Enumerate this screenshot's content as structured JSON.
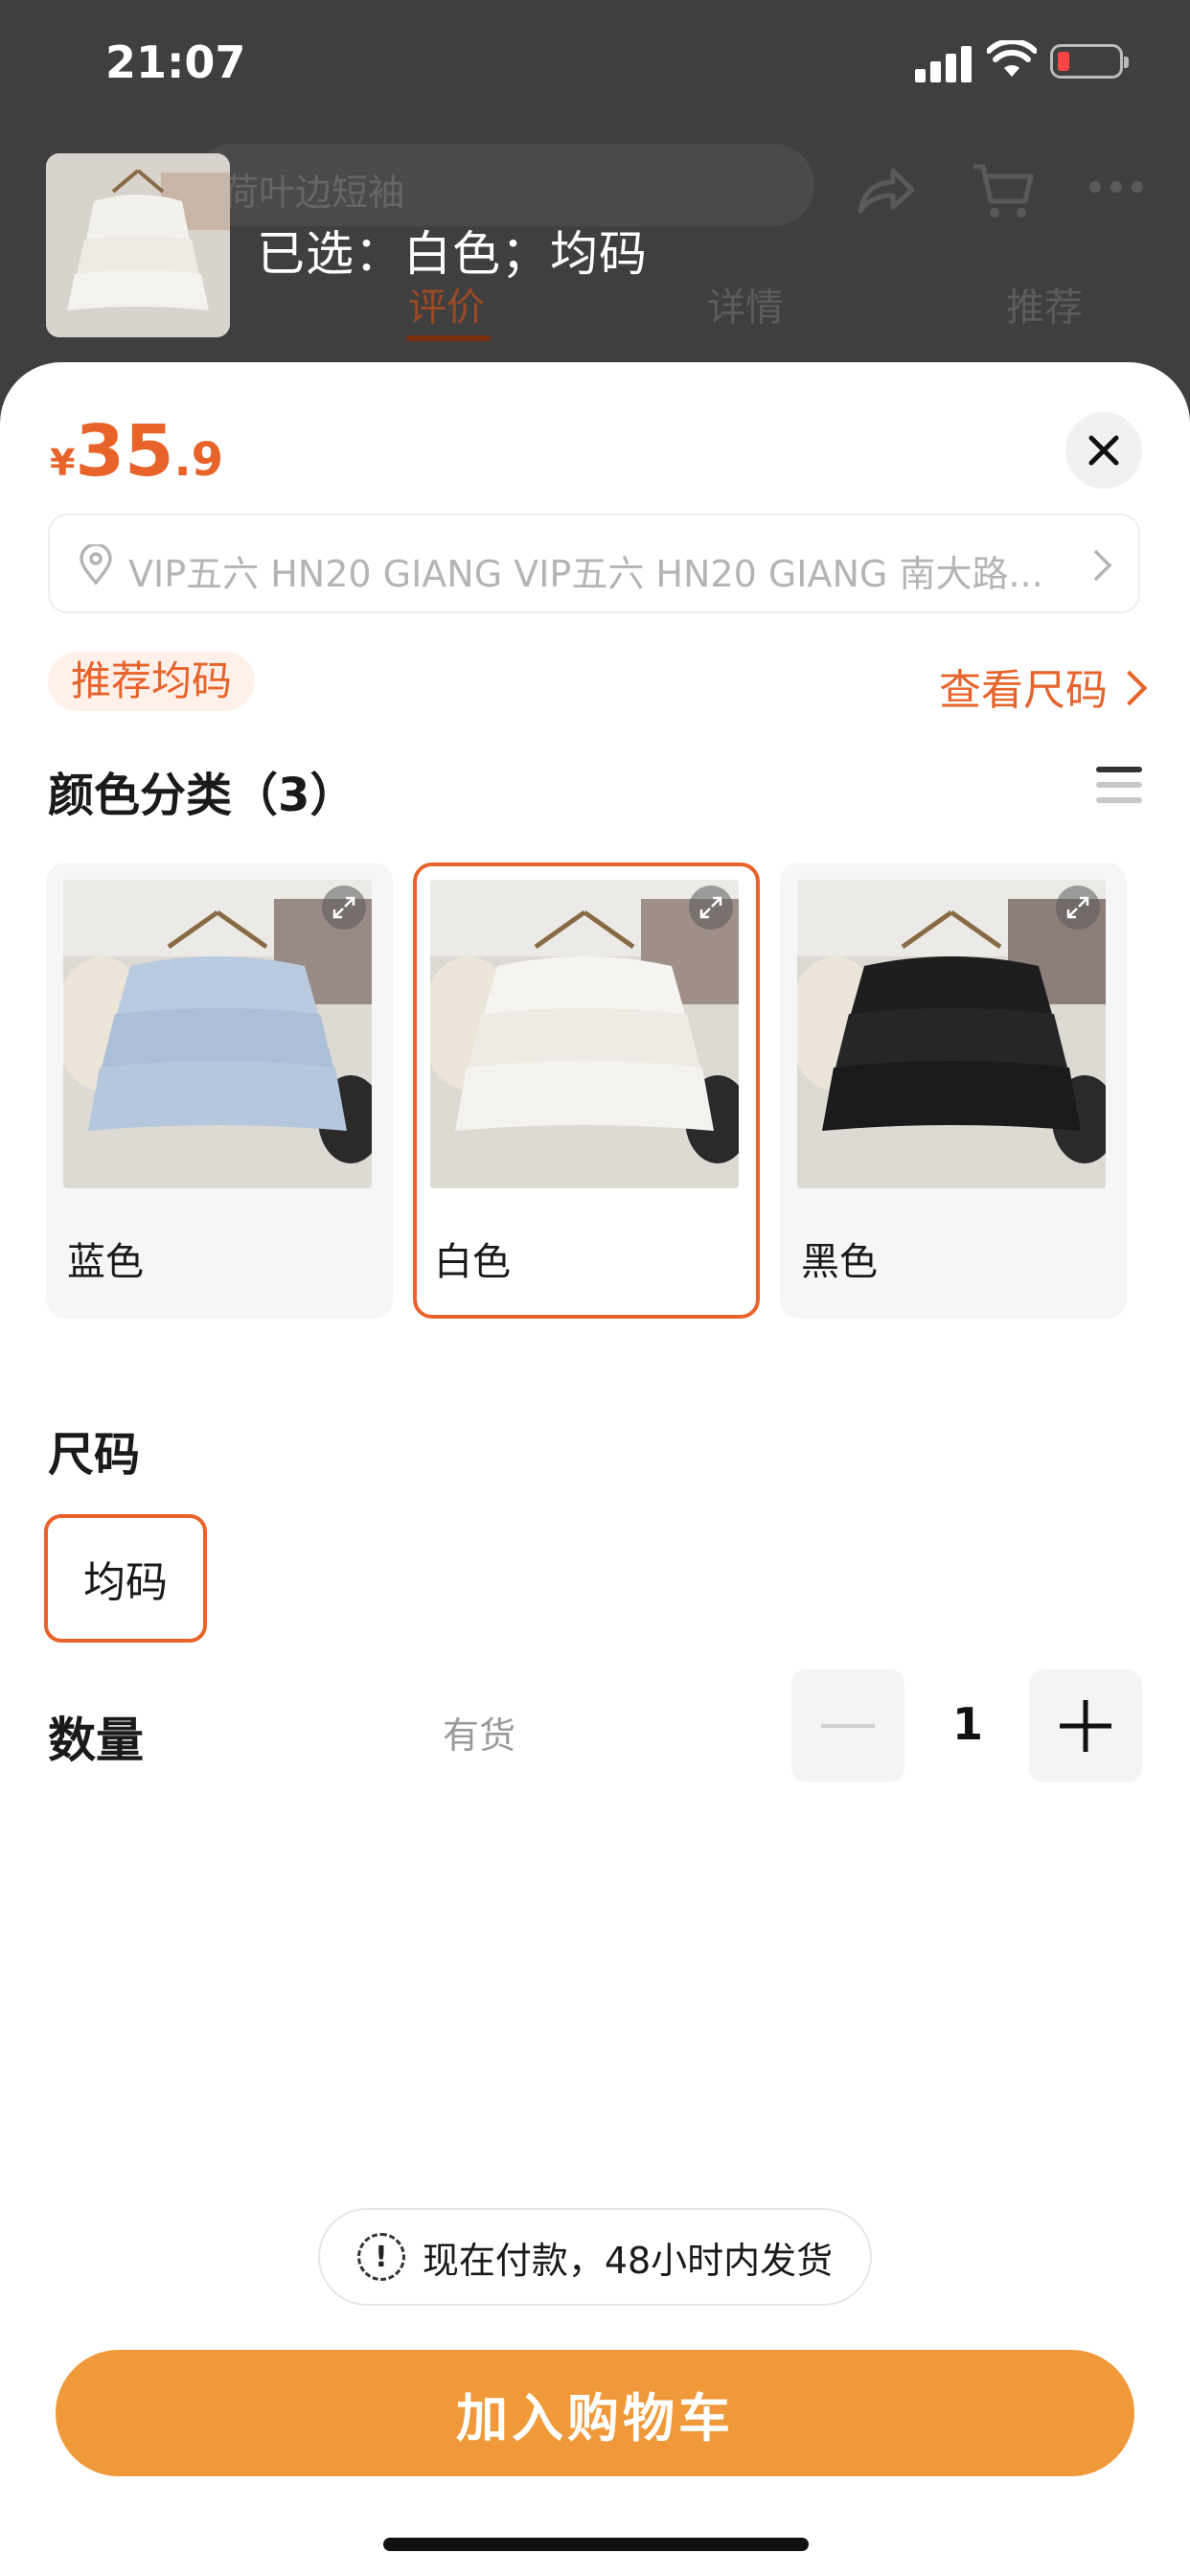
{
  "status_bar": {
    "time": "21:07"
  },
  "header": {
    "title_partial": "荷叶边短袖",
    "selected": "已选：白色；均码",
    "tabs": [
      "评价",
      "详情",
      "推荐"
    ]
  },
  "sheet": {
    "price": {
      "currency": "¥",
      "integer": "35",
      "decimal": ".9"
    },
    "address": "VIP五六 HN20 GIANG VIP五六 HN20 GIANG 南大路...",
    "recommend_tag": "推荐均码",
    "size_guide": "查看尺码",
    "color_section_title": "颜色分类（3）",
    "colors": [
      {
        "label": "蓝色",
        "selected": false,
        "swatch": "#b9cbe0"
      },
      {
        "label": "白色",
        "selected": true,
        "swatch": "#f4f2ee"
      },
      {
        "label": "黑色",
        "selected": false,
        "swatch": "#1e1e1e"
      }
    ],
    "size_section_title": "尺码",
    "sizes": [
      {
        "label": "均码",
        "selected": true
      }
    ],
    "quantity_label": "数量",
    "stock_status": "有货",
    "quantity": "1",
    "notice": "现在付款，48小时内发货",
    "add_to_cart": "加入购物车",
    "accent_color": "#e8632a",
    "cart_button_color": "#f0993a"
  }
}
